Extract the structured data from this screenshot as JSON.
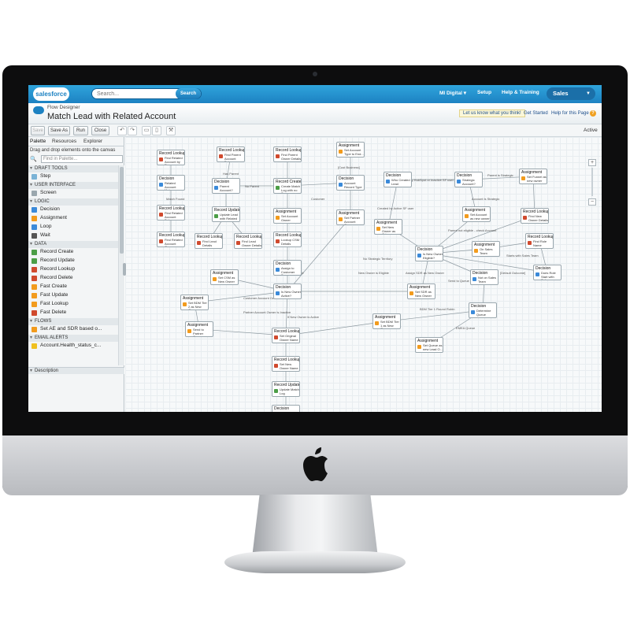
{
  "header": {
    "logo": "salesforce",
    "search_placeholder": "Search...",
    "search_button": "Search",
    "links": [
      "MI Digital ▾",
      "Setup",
      "Help & Training"
    ],
    "app": "Sales"
  },
  "page": {
    "subtitle": "Flow Designer",
    "title": "Match Lead with Related Account",
    "feedback": "Let us know what you think!",
    "get_started": "Get Started",
    "help": "Help for this Page"
  },
  "toolbar": {
    "save": "Save",
    "save_as": "Save As",
    "run": "Run",
    "close": "Close",
    "status": "Active"
  },
  "palette": {
    "tabs": [
      "Palette",
      "Resources",
      "Explorer"
    ],
    "hint": "Drag and drop elements onto the canvas",
    "search_placeholder": "Find in Palette...",
    "sections": [
      {
        "title": "DRAFT TOOLS",
        "items": [
          "Step"
        ]
      },
      {
        "title": "USER INTERFACE",
        "items": [
          "Screen"
        ]
      },
      {
        "title": "LOGIC",
        "items": [
          "Decision",
          "Assignment",
          "Loop",
          "Wait"
        ]
      },
      {
        "title": "DATA",
        "items": [
          "Record Create",
          "Record Update",
          "Record Lookup",
          "Record Delete",
          "Fast Create",
          "Fast Update",
          "Fast Lookup",
          "Fast Delete"
        ]
      },
      {
        "title": "FLOWS",
        "items": [
          "Set AE and SDR based o..."
        ]
      },
      {
        "title": "EMAIL ALERTS",
        "items": [
          "Account.Health_status_c..."
        ]
      }
    ],
    "description": "Description"
  },
  "colors": {
    "header_blue": "#1d82c2",
    "lookup": "#d04a2e",
    "decision": "#3b8ad9",
    "assignment": "#f29b1d",
    "create": "#4c9e47"
  },
  "flow": {
    "nodes": [
      {
        "type": "Record Lookup",
        "name": "Find Related Account by E..."
      },
      {
        "type": "Decision",
        "name": "Related Account Matc..."
      },
      {
        "type": "Record Lookup",
        "name": "Find Related Account Deta..."
      },
      {
        "type": "Record Lookup",
        "name": "Find Related Account Own..."
      },
      {
        "type": "Record Lookup",
        "name": "Find Parent Account Deta..."
      },
      {
        "type": "Decision",
        "name": "Parent Account?"
      },
      {
        "type": "Record Update",
        "name": "Update Lead with Related ..."
      },
      {
        "type": "Record Lookup",
        "name": "Find Lead Details"
      },
      {
        "type": "Record Lookup",
        "name": "Find Lead Owner Details"
      },
      {
        "type": "Record Lookup",
        "name": "Find Parent Owner Details"
      },
      {
        "type": "Record Create",
        "name": "Create Match Log with no S..."
      },
      {
        "type": "Assignment",
        "name": "Set Account Owner"
      },
      {
        "type": "Record Lookup",
        "name": "Lookup CSM Details"
      },
      {
        "type": "Decision",
        "name": "Assign to Customer Su..."
      },
      {
        "type": "Assignment",
        "name": "Set CSM as New Owner"
      },
      {
        "type": "Decision",
        "name": "Is New Owner Active?"
      },
      {
        "type": "Assignment",
        "name": "Set BDM Tier 2 as New Owner"
      },
      {
        "type": "Assignment",
        "name": "Send to Partner Queue"
      },
      {
        "type": "Record Lookup",
        "name": "Set Original Owner Name"
      },
      {
        "type": "Record Lookup",
        "name": "Set New Owner Name"
      },
      {
        "type": "Record Update",
        "name": "Update Match Log"
      },
      {
        "type": "Decision",
        "name": ""
      },
      {
        "type": "Assignment",
        "name": "Set Account Type to End..."
      },
      {
        "type": "Decision",
        "name": "Account Record Type"
      },
      {
        "type": "Assignment",
        "name": "Set Partner Account Owner"
      },
      {
        "type": "Decision",
        "name": "Who Created Lead"
      },
      {
        "type": "Assignment",
        "name": "Set New Owner as Ori..."
      },
      {
        "type": "Decision",
        "name": "Strategic Account?"
      },
      {
        "type": "Assignment",
        "name": "Set Account as new owner"
      },
      {
        "type": "Assignment",
        "name": "Set Funnel as new owner"
      },
      {
        "type": "Record Lookup",
        "name": "Find New Owner Details"
      },
      {
        "type": "Decision",
        "name": "Is New Owner Eligible?"
      },
      {
        "type": "Assignment",
        "name": "On Sales Team"
      },
      {
        "type": "Record Lookup",
        "name": "Find Role Name"
      },
      {
        "type": "Decision",
        "name": "Does Role Start with Sal..."
      },
      {
        "type": "Assignment",
        "name": "Set SDR as New Owner"
      },
      {
        "type": "Decision",
        "name": "Not on Sales Team"
      },
      {
        "type": "Decision",
        "name": "Determine Queue"
      },
      {
        "type": "Assignment",
        "name": "Set BDM Tier 1 as New Owner"
      },
      {
        "type": "Assignment",
        "name": "Set Queue as new Lead O..."
      }
    ],
    "edge_labels": [
      "Has Parent",
      "No Parent",
      "Match Found",
      "[Cust Business]",
      "Customer",
      "Partner",
      "Created by Active SF user",
      "Created by HubSpot or Inactive SF user",
      "Parent is Strategic",
      "Account is Strategic",
      "Parent not eligible - check Account",
      "Starts with Sales Team",
      "[Default Outcome]",
      "No Strategic Territory",
      "New Owner is Eligible",
      "Assign SDR as New Owner",
      "Send to Queue",
      "Assign to CSM",
      "Customer Account Owner is Inactive",
      "Partner Account Owner is Inactive",
      "If New Owner is Active",
      "BDM Tier 1 Round Robin",
      "EMEA Queue"
    ]
  }
}
